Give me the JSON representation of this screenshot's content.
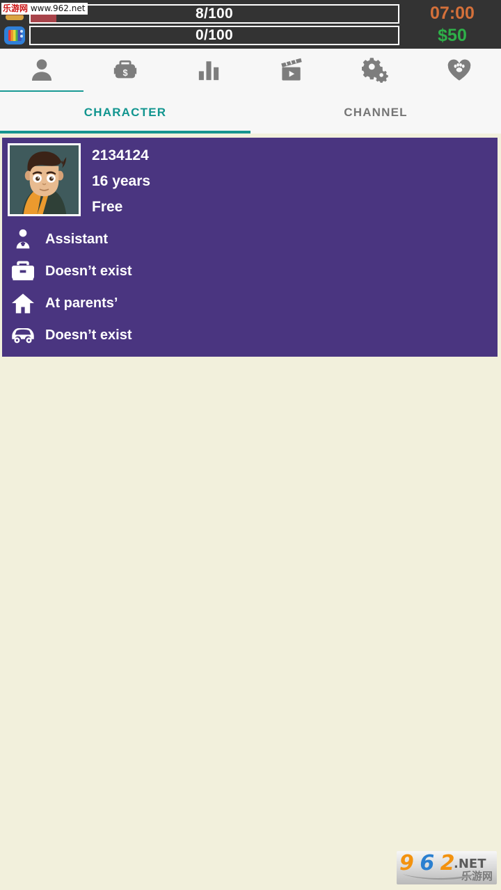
{
  "status_bar": {
    "bg_color": "#333333",
    "meters": [
      {
        "icon": "burger-icon",
        "name": "food-meter",
        "label": "8/100",
        "value": 8,
        "max": 100,
        "fill_color": "#a8434a",
        "fill_percent": 7
      },
      {
        "icon": "tv-icon",
        "name": "channel-meter",
        "label": "0/100",
        "value": 0,
        "max": 100,
        "fill_color": "#a8434a",
        "fill_percent": 0
      }
    ],
    "clock": "07:00",
    "clock_color": "#d4703a",
    "money": "$50",
    "money_color": "#2eb049"
  },
  "icon_tabs": {
    "active_index": 0,
    "indicator_color": "#1a9a95",
    "items": [
      {
        "icon": "person-icon",
        "label": "Character",
        "active": true
      },
      {
        "icon": "briefcase-dollar-icon",
        "label": "Work",
        "active": false
      },
      {
        "icon": "bar-chart-icon",
        "label": "Stats",
        "active": false
      },
      {
        "icon": "clapperboard-icon",
        "label": "Videos",
        "active": false
      },
      {
        "icon": "gears-icon",
        "label": "Settings",
        "active": false
      },
      {
        "icon": "heart-paw-icon",
        "label": "Pets",
        "active": false
      }
    ]
  },
  "text_tabs": {
    "active_index": 0,
    "active_color": "#11958f",
    "inactive_color": "#757575",
    "items": [
      {
        "label": "CHARACTER",
        "active": true
      },
      {
        "label": "CHANNEL",
        "active": false
      }
    ]
  },
  "character_card": {
    "bg_color": "#4a3580",
    "avatar": {
      "name": "character-avatar",
      "bg_color": "#3f5a5c",
      "hair_color": "#3b2317",
      "skin_color": "#e0b48c",
      "shirt_color": "#eb9a2e",
      "shirt_alt_color": "#2f4037"
    },
    "name": "2134124",
    "age": "16 years",
    "status": "Free",
    "attributes": [
      {
        "icon": "person-tie-icon",
        "label": "Assistant"
      },
      {
        "icon": "briefcase-icon",
        "label": "Doesn’t exist"
      },
      {
        "icon": "house-icon",
        "label": "At parents’"
      },
      {
        "icon": "car-icon",
        "label": "Doesn’t exist"
      }
    ]
  },
  "watermarks": {
    "top": {
      "cn": "乐游网",
      "url": "www.962.net"
    },
    "bottom": {
      "num_9": "9",
      "num_6": "6",
      "num_2": "2",
      "net": ".NET",
      "cn": "乐游网"
    }
  },
  "page": {
    "background_color": "#f2f0dc"
  }
}
